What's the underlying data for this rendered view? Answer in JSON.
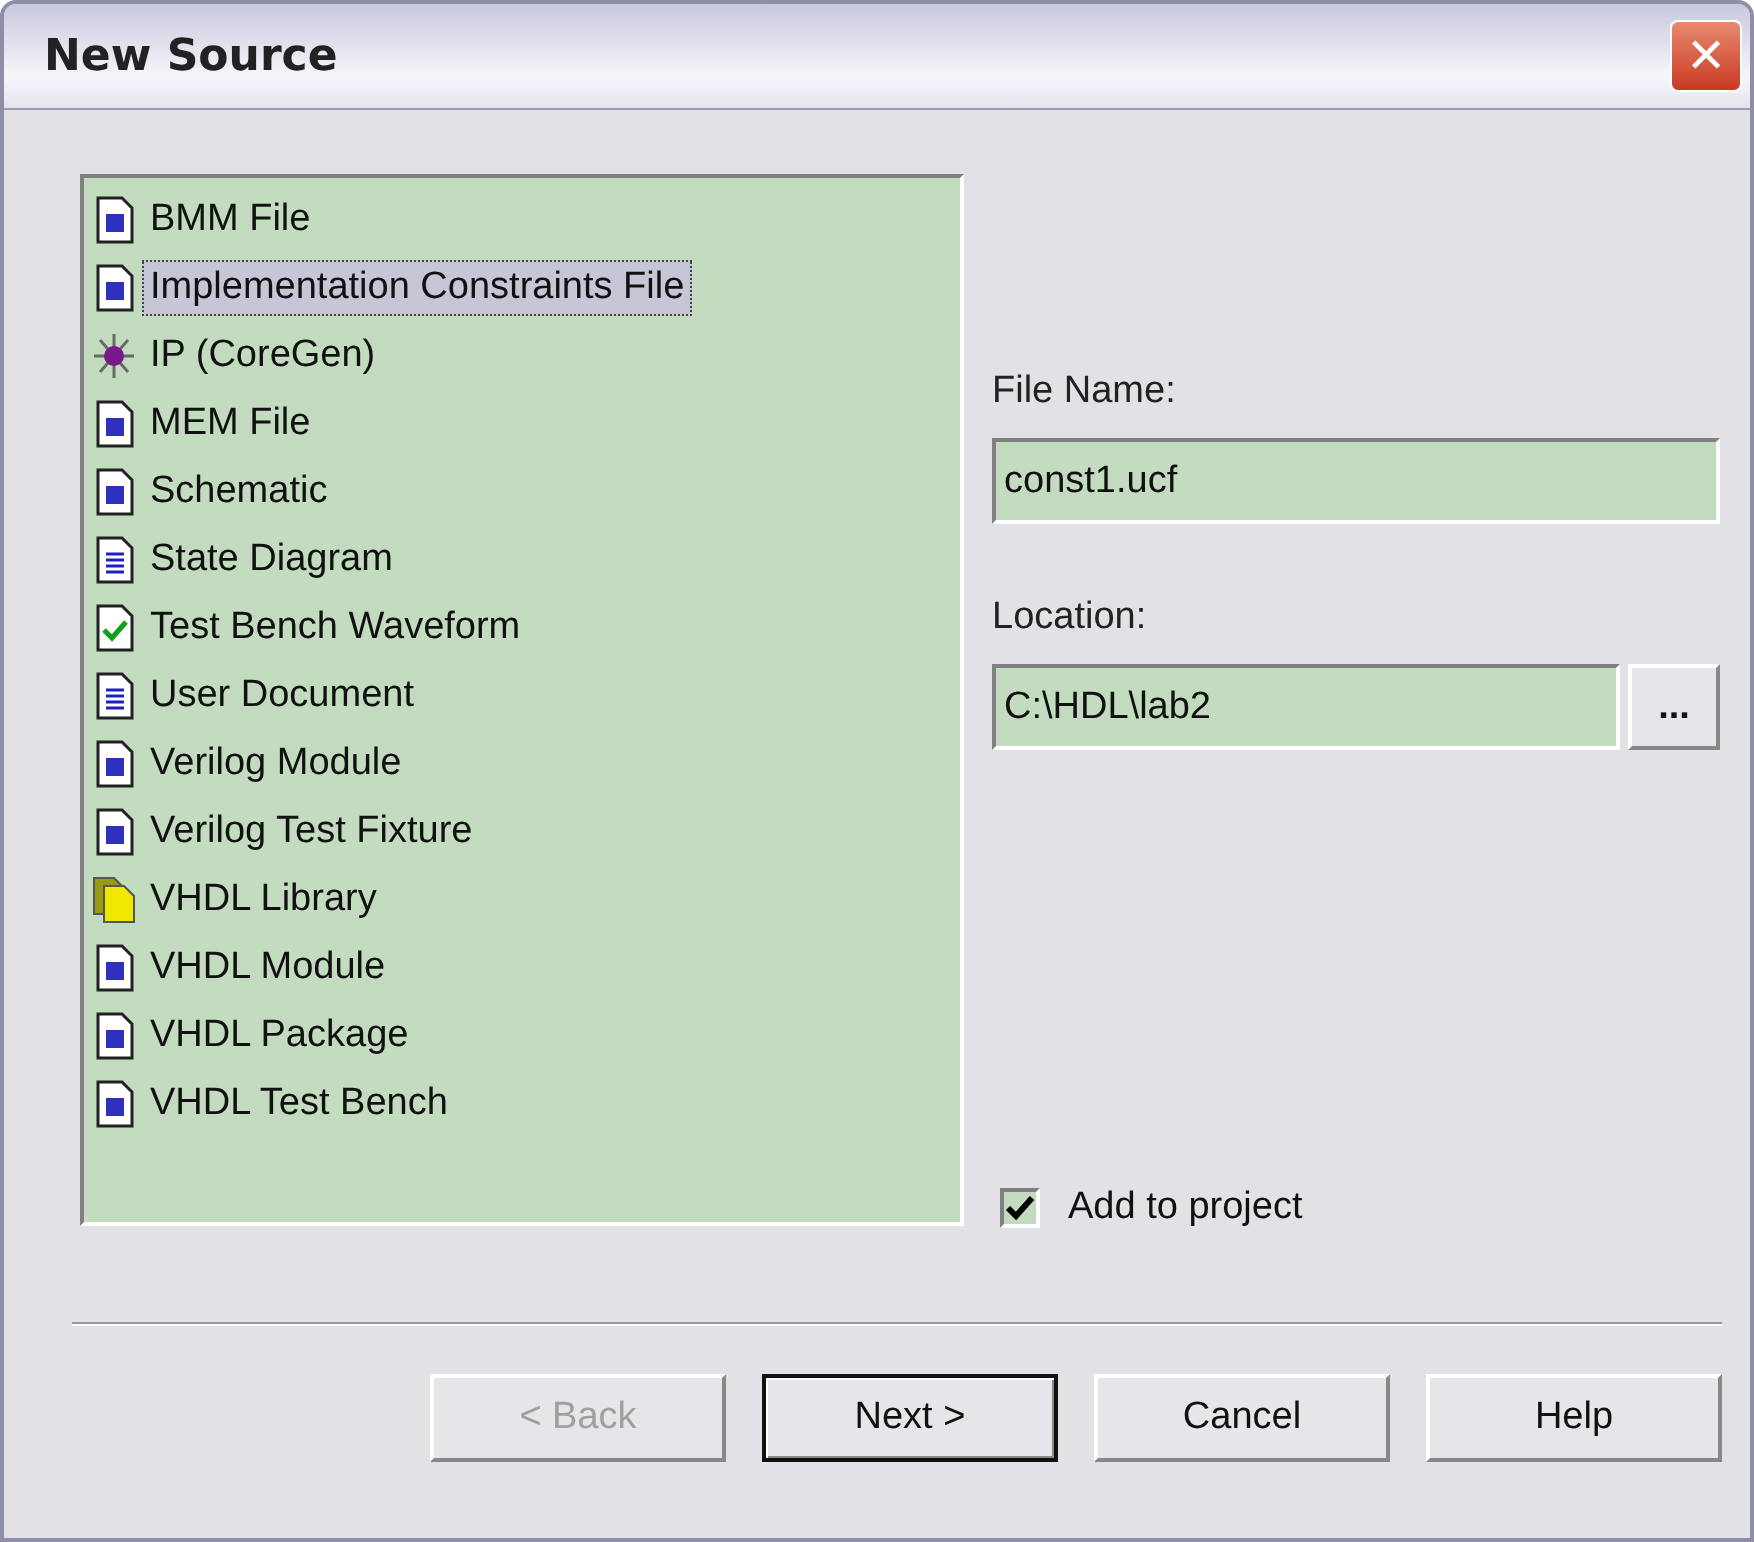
{
  "window": {
    "title": "New Source",
    "close": "✕"
  },
  "source_types": [
    {
      "label": "BMM File",
      "kind": "document",
      "selected": false
    },
    {
      "label": "Implementation Constraints File",
      "kind": "document",
      "selected": true
    },
    {
      "label": "IP (CoreGen)",
      "kind": "chip",
      "selected": false
    },
    {
      "label": "MEM File",
      "kind": "document",
      "selected": false
    },
    {
      "label": "Schematic",
      "kind": "document",
      "selected": false
    },
    {
      "label": "State Diagram",
      "kind": "lines",
      "selected": false
    },
    {
      "label": "Test Bench Waveform",
      "kind": "check",
      "selected": false
    },
    {
      "label": "User Document",
      "kind": "lines",
      "selected": false
    },
    {
      "label": "Verilog Module",
      "kind": "document",
      "selected": false
    },
    {
      "label": "Verilog Test Fixture",
      "kind": "document",
      "selected": false
    },
    {
      "label": "VHDL Library",
      "kind": "library",
      "selected": false
    },
    {
      "label": "VHDL Module",
      "kind": "document",
      "selected": false
    },
    {
      "label": "VHDL Package",
      "kind": "document",
      "selected": false
    },
    {
      "label": "VHDL Test Bench",
      "kind": "document",
      "selected": false
    }
  ],
  "file_name": {
    "label": "File Name:",
    "value": "const1.ucf"
  },
  "location": {
    "label": "Location:",
    "value": "C:\\HDL\\lab2",
    "browse": "..."
  },
  "add_to_project": {
    "label": "Add to project",
    "checked": true
  },
  "buttons": [
    {
      "label": "< Back",
      "disabled": true,
      "default": false
    },
    {
      "label": "Next >",
      "disabled": false,
      "default": true
    },
    {
      "label": "Cancel",
      "disabled": false,
      "default": false
    },
    {
      "label": "Help",
      "disabled": false,
      "default": false
    }
  ]
}
